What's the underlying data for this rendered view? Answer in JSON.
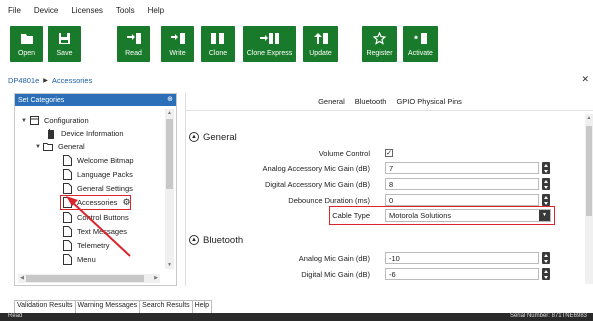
{
  "menu": [
    "File",
    "Device",
    "Licenses",
    "Tools",
    "Help"
  ],
  "toolbar": {
    "accent": "#1a7a2b",
    "buttons": [
      {
        "label": "Open",
        "icon": "folder-icon"
      },
      {
        "label": "Save",
        "icon": "save-icon"
      },
      {
        "label": "Read",
        "icon": "read-icon"
      },
      {
        "label": "Write",
        "icon": "write-icon"
      },
      {
        "label": "Clone",
        "icon": "clone-icon"
      },
      {
        "label": "Clone Express",
        "icon": "clone-express-icon"
      },
      {
        "label": "Update",
        "icon": "update-icon"
      },
      {
        "label": "Register",
        "icon": "star-icon"
      },
      {
        "label": "Activate",
        "icon": "activate-icon"
      }
    ]
  },
  "breadcrumb": [
    "DP4801e",
    "Accessories"
  ],
  "left_panel": {
    "title": "Set Categories",
    "tree": {
      "configuration": "Configuration",
      "device_information": "Device Information",
      "general": "General",
      "welcome_bitmap": "Welcome Bitmap",
      "language_packs": "Language Packs",
      "general_settings": "General Settings",
      "accessories": "Accessories",
      "control_buttons": "Control Buttons",
      "text_messages": "Text Messages",
      "telemetry": "Telemetry",
      "menu": "Menu"
    }
  },
  "right_panel": {
    "tabs": [
      "General",
      "Bluetooth",
      "GPIO Physical Pins"
    ],
    "sections": {
      "general": "General",
      "bluetooth": "Bluetooth"
    },
    "fields": {
      "volume_control": {
        "label": "Volume Control",
        "checked": "✓"
      },
      "analog_accessory_mic_gain": {
        "label": "Analog Accessory Mic Gain (dB)",
        "value": "7"
      },
      "digital_accessory_mic_gain": {
        "label": "Digital Accessory Mic Gain (dB)",
        "value": "8"
      },
      "debounce_duration": {
        "label": "Debounce Duration (ms)",
        "value": "0"
      },
      "cable_type": {
        "label": "Cable Type",
        "value": "Motorola Solutions"
      },
      "analog_mic_gain": {
        "label": "Analog Mic Gain (dB)",
        "value": "-10"
      },
      "digital_mic_gain": {
        "label": "Digital Mic Gain (dB)",
        "value": "-6"
      }
    }
  },
  "bottom_tabs": [
    "Validation Results",
    "Warning Messages",
    "Search Results",
    "Help"
  ],
  "status": {
    "left": "Read",
    "right": "Serial Number: 871TNE6983"
  },
  "highlight_color": "#d9262c"
}
